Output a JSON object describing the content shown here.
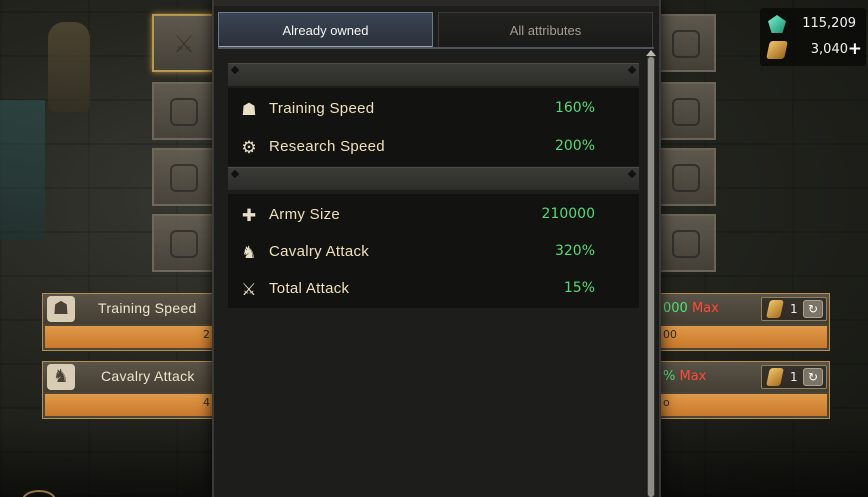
{
  "currency": {
    "gems": "115,209",
    "gold": "3,040",
    "plus": "+"
  },
  "background": {
    "rows": [
      {
        "label": "Training Speed",
        "left_value": "2",
        "max_number": "000",
        "max_label": "Max",
        "bar_value": "00",
        "coin_qty": "1"
      },
      {
        "label": "Cavalry Attack",
        "left_value": "4",
        "max_number": "%",
        "max_label": "Max",
        "bar_value": "o",
        "coin_qty": "1"
      }
    ]
  },
  "modal": {
    "tabs": [
      {
        "label": "Already owned",
        "active": true
      },
      {
        "label": "All attributes",
        "active": false
      }
    ],
    "sections": [
      {
        "items": [
          {
            "icon": "helmet-icon",
            "name": "Training Speed",
            "value": "160%"
          },
          {
            "icon": "research-icon",
            "name": "Research Speed",
            "value": "200%"
          }
        ]
      },
      {
        "items": [
          {
            "icon": "shield-cross-icon",
            "name": "Army Size",
            "value": "210000"
          },
          {
            "icon": "horse-icon",
            "name": "Cavalry Attack",
            "value": "320%"
          },
          {
            "icon": "crossed-swords-icon",
            "name": "Total Attack",
            "value": "15%"
          }
        ]
      }
    ]
  },
  "colors": {
    "value_green": "#56d976",
    "max_red": "#ff4a3a",
    "bar_orange": "#e09a48",
    "label_gold": "#efe0bb"
  }
}
